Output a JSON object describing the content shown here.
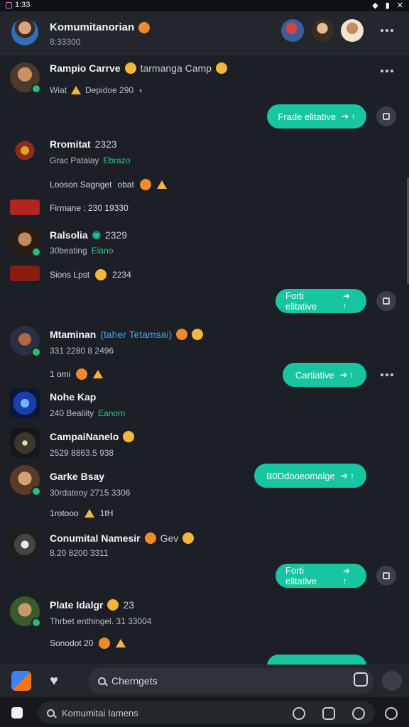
{
  "status": {
    "time": "1:33",
    "icons": [
      "wifi-icon",
      "battery-icon",
      "signal-icon"
    ]
  },
  "header": {
    "title": "Komumitanorian",
    "subtitle": "8:33300",
    "more_label": "•••"
  },
  "feed": [
    {
      "name": "Rampio Carrve",
      "extra": "tarmanga Camp",
      "sub": "Wiat",
      "sub2": "Depidoe 290"
    },
    {
      "pill": "Frade elitative"
    },
    {
      "name": "Rromitat",
      "extra": "2323",
      "sub": "Grac Patalay",
      "sub_green": "Ebrazo",
      "line": "Looson Sagnget",
      "line2": "obat"
    },
    {
      "line": "Firmane : 230 19330"
    },
    {
      "name": "Ralsolia",
      "extra": "2329",
      "sub": "30beating",
      "sub_green": "Eiano"
    },
    {
      "line": "Sions Lpst",
      "line2": "2234"
    },
    {
      "pill": "Forti elitative"
    },
    {
      "name": "Mtaminan",
      "link": "(taher Tetamsai)",
      "sub": "331 2280 8 2496",
      "line": "1 omi"
    },
    {
      "pill": "Cartiative"
    },
    {
      "name": "Nohe Kap",
      "sub": "240 Bealiity",
      "sub_green": "Eanom"
    },
    {
      "name": "CampaiNanelo",
      "sub": "2529 8863.5 938"
    },
    {
      "name": "Garke Bsay",
      "sub": "30rdateoy 2715 3306",
      "line": "1rotooo",
      "line2": "1tH",
      "pill": "B0Ddooeomalge"
    },
    {
      "name": "Conumital Namesir",
      "extra": "Gev",
      "sub": "8.20 8200 3311"
    },
    {
      "pill": "Forti elitative"
    },
    {
      "name": "Plate Idalgr",
      "extra": "23",
      "sub": "Thrbet enthingel. 31 33004",
      "line": "Sonodot 20"
    }
  ],
  "composer": {
    "placeholder": "Cherngets"
  },
  "bottom": {
    "search_text": "Komumitai Iamens"
  }
}
